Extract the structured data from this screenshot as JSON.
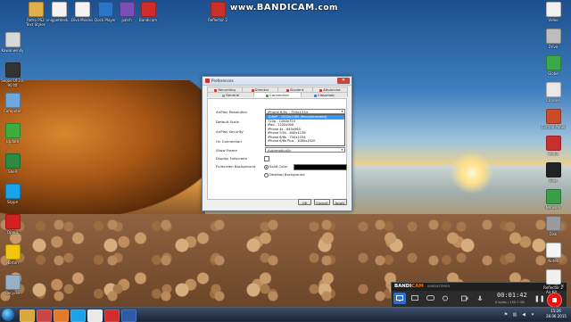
{
  "watermark": {
    "prefix": "www.",
    "text": "BANDICAM",
    "suffix": ".com"
  },
  "desktop_icons": {
    "left": [
      {
        "label": "Kawanwindy",
        "color": "#d8d8d8"
      },
      {
        "label": "Segoe UI 2.6 90 ttf",
        "color": "#333333"
      },
      {
        "label": "Computer",
        "color": "#6ea9d9"
      },
      {
        "label": "Update",
        "color": "#3cae3c"
      },
      {
        "label": "Shell",
        "color": "#2e8b3e"
      },
      {
        "label": "Skype",
        "color": "#1aa3e8"
      },
      {
        "label": "Opera",
        "color": "#d21f1f"
      },
      {
        "label": "Norton",
        "color": "#f2c30f"
      },
      {
        "label": "Recycle",
        "color": "#9ab0c4"
      }
    ],
    "top": [
      {
        "label": "Kawanwindy",
        "color": "#e0e0e0"
      },
      {
        "label": "Retro PS2 Text Styles",
        "color": "#e1b04a"
      },
      {
        "label": "snippetdesk...",
        "color": "#f4f4f4"
      },
      {
        "label": "Diva Movies",
        "color": "#f4f4f4"
      },
      {
        "label": "Dock Player",
        "color": "#2a75c7"
      },
      {
        "label": "patch",
        "color": "#7a4fb5"
      },
      {
        "label": "Bandicam",
        "color": "#d12b2b"
      },
      {
        "label": "Reflector 2",
        "color": "#c9302c"
      }
    ],
    "right": [
      {
        "label": "Video",
        "color": "#f1f1f1"
      },
      {
        "label": "Drive",
        "color": "#bdbdbd"
      },
      {
        "label": "Globe",
        "color": "#3ba84b"
      },
      {
        "label": "Chrome",
        "color": "#e8e8e8"
      },
      {
        "label": "Control Panel",
        "color": "#c94b2a"
      },
      {
        "label": "Media",
        "color": "#c83030"
      },
      {
        "label": "Files",
        "color": "#222222"
      },
      {
        "label": "Network",
        "color": "#3a9e49"
      },
      {
        "label": "Disk",
        "color": "#9a9a9a"
      },
      {
        "label": "Notes",
        "color": "#f4f4f4"
      },
      {
        "label": "Reflector 2 Air Kit...",
        "color": "#f0f0f0"
      }
    ]
  },
  "dialog": {
    "title": "Preferences",
    "tabs_row1": [
      {
        "label": "Recording",
        "color": "#c33"
      },
      {
        "label": "Director",
        "color": "#c33"
      },
      {
        "label": "Student",
        "color": "#c33"
      },
      {
        "label": "Advanced",
        "color": "#c33"
      }
    ],
    "tabs_row2": [
      {
        "label": "General",
        "color": "#9a9a9a"
      },
      {
        "label": "Connection",
        "color": "#3aa34a"
      },
      {
        "label": "Classmob",
        "color": "#3a7bd5"
      }
    ],
    "fields": {
      "airplay_resolution": {
        "label": "AirPlay Resolution",
        "value": "iPhone 6/5s - 750x1334"
      },
      "default_scale": {
        "label": "Default Scale"
      },
      "airplay_security": {
        "label": "AirPlay Security"
      },
      "on_connection": {
        "label": "On Connection"
      },
      "show_frame": {
        "label": "Show Frame",
        "value": "Automatically"
      },
      "display_fullscreen": {
        "label": "Display Fullscreen"
      },
      "fullscreen_background": {
        "label": "Fullscreen Background"
      }
    },
    "dropdown_options": [
      {
        "text": "1080P - 1920x1080 (Recommended)",
        "selected": true
      },
      {
        "text": "720p - 1280x720",
        "selected": false
      },
      {
        "text": "iPad - 1200x900",
        "selected": false
      },
      {
        "text": "iPhone 4s - 640x960",
        "selected": false
      },
      {
        "text": "iPhone 5/5s - 640x1136",
        "selected": false
      },
      {
        "text": "iPhone 6/6s - 750x1334",
        "selected": false
      },
      {
        "text": "iPhone 6/6s Plus - 1080x1920",
        "selected": false
      }
    ],
    "radios": [
      {
        "label": "Solid Color",
        "on": true
      },
      {
        "label": "Desktop Background",
        "on": false
      }
    ],
    "buttons": {
      "ok": "OK",
      "cancel": "Cancel",
      "apply": "Apply"
    }
  },
  "bandicam": {
    "brand": "BANDI",
    "brand_accent": "CAM",
    "sub": "UNREGISTERED",
    "timer": "00:01:42",
    "size": "0 bytes / 155.7 GB",
    "accent_color": "#2f6fc3"
  },
  "taskbar": {
    "items": [
      {
        "name": "explorer",
        "color": "#d9a83a"
      },
      {
        "name": "media",
        "color": "#c44"
      },
      {
        "name": "firefox",
        "color": "#e5792a"
      },
      {
        "name": "skype",
        "color": "#1aa3e8"
      },
      {
        "name": "chrome",
        "color": "#e9e9e9"
      },
      {
        "name": "bandicam",
        "color": "#d12b2b"
      },
      {
        "name": "word",
        "color": "#2b5ba8"
      }
    ],
    "clock_time": "15:26",
    "clock_date": "28.06.2015"
  }
}
